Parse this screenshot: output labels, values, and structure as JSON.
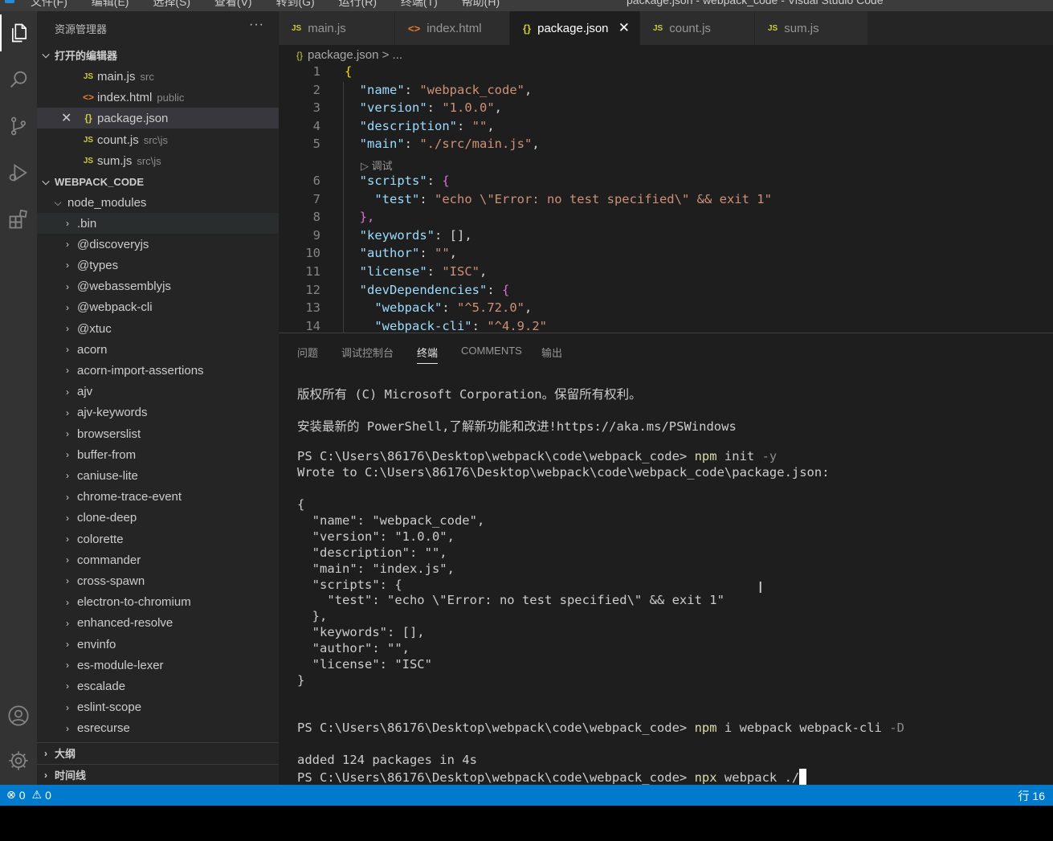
{
  "window": {
    "menus": [
      "文件(F)",
      "编辑(E)",
      "选择(S)",
      "查看(V)",
      "转到(G)",
      "运行(R)",
      "终端(T)",
      "帮助(H)"
    ],
    "title": "package.json - webpack_code - Visual Studio Code"
  },
  "activity_bar": {
    "icons": [
      "files-icon",
      "search-icon",
      "source-control-icon",
      "run-debug-icon",
      "extensions-icon",
      "account-icon",
      "settings-gear-icon"
    ]
  },
  "sidebar": {
    "title": "资源管理器",
    "more": "···",
    "open_editors": {
      "label": "打开的编辑器",
      "items": [
        {
          "icon": "JS",
          "name": "main.js",
          "desc": "src"
        },
        {
          "icon": "<>",
          "name": "index.html",
          "desc": "public"
        },
        {
          "icon": "{}",
          "name": "package.json",
          "desc": ""
        },
        {
          "icon": "JS",
          "name": "count.js",
          "desc": "src\\js"
        },
        {
          "icon": "JS",
          "name": "sum.js",
          "desc": "src\\js"
        }
      ],
      "close_glyph": "✕"
    },
    "project": {
      "label": "WEBPACK_CODE",
      "node_modules": "node_modules",
      "folders": [
        ".bin",
        "@discoveryjs",
        "@types",
        "@webassemblyjs",
        "@webpack-cli",
        "@xtuc",
        "acorn",
        "acorn-import-assertions",
        "ajv",
        "ajv-keywords",
        "browserslist",
        "buffer-from",
        "caniuse-lite",
        "chrome-trace-event",
        "clone-deep",
        "colorette",
        "commander",
        "cross-spawn",
        "electron-to-chromium",
        "enhanced-resolve",
        "envinfo",
        "es-module-lexer",
        "escalade",
        "eslint-scope",
        "esrecurse"
      ]
    },
    "outline": "大纲",
    "timeline": "时间线"
  },
  "tabs": [
    {
      "icon": "JS",
      "label": "main.js",
      "active": false
    },
    {
      "icon": "<>",
      "label": "index.html",
      "active": false
    },
    {
      "icon": "{}",
      "label": "package.json",
      "active": true
    },
    {
      "icon": "JS",
      "label": "count.js",
      "active": false
    },
    {
      "icon": "JS",
      "label": "sum.js",
      "active": false
    }
  ],
  "editor": {
    "breadcrumb": {
      "file": "package.json",
      "rest": " > ..."
    },
    "codelens": "▷ 调试",
    "lines": [
      {
        "n": "1",
        "k": "",
        "v": "",
        "pre": "",
        "open": "{"
      },
      {
        "n": "2",
        "k": "\"name\"",
        "v": "\"webpack_code\""
      },
      {
        "n": "3",
        "k": "\"version\"",
        "v": "\"1.0.0\""
      },
      {
        "n": "4",
        "k": "\"description\"",
        "v": "\"\""
      },
      {
        "n": "5",
        "k": "\"main\"",
        "v": "\"./src/main.js\""
      },
      {
        "n": "6",
        "k": "\"scripts\"",
        "v": "{"
      },
      {
        "n": "7",
        "k": "\"test\"",
        "v": "\"echo \\\"Error: no test specified\\\" && exit 1\""
      },
      {
        "n": "8",
        "k": "",
        "v": "},"
      },
      {
        "n": "9",
        "k": "\"keywords\"",
        "v": "[],"
      },
      {
        "n": "10",
        "k": "\"author\"",
        "v": "\"\""
      },
      {
        "n": "11",
        "k": "\"license\"",
        "v": "\"ISC\""
      },
      {
        "n": "12",
        "k": "\"devDependencies\"",
        "v": "{"
      },
      {
        "n": "13",
        "k": "\"webpack\"",
        "v": "\"^5.72.0\""
      },
      {
        "n": "14",
        "k": "\"webpack-cli\"",
        "v": "\"^4.9.2\""
      }
    ]
  },
  "panel": {
    "tabs": [
      "问题",
      "调试控制台",
      "终端",
      "COMMENTS",
      "输出"
    ],
    "active_tab": "终端",
    "terminal": {
      "copyright": "版权所有 (C) Microsoft Corporation。保留所有权利。",
      "install_hint": "安装最新的 PowerShell,了解新功能和改进!https://aka.ms/PSWindows",
      "prompt": "PS C:\\Users\\86176\\Desktop\\webpack\\code\\webpack_code> ",
      "cmd1": {
        "cmd": "npm",
        "args": " init ",
        "flag": "-y"
      },
      "wrote": "Wrote to C:\\Users\\86176\\Desktop\\webpack\\code\\webpack_code\\package.json:",
      "json": [
        "{",
        "  \"name\": \"webpack_code\",",
        "  \"version\": \"1.0.0\",",
        "  \"description\": \"\",",
        "  \"main\": \"index.js\",",
        "  \"scripts\": {",
        "    \"test\": \"echo \\\"Error: no test specified\\\" && exit 1\"",
        "  },",
        "  \"keywords\": [],",
        "  \"author\": \"\",",
        "  \"license\": \"ISC\"",
        "}"
      ],
      "cmd2": {
        "cmd": "npm",
        "args": " i webpack webpack-cli ",
        "flag": "-D"
      },
      "added": "added 124 packages in 4s",
      "cmd3": {
        "cmd": "npx",
        "args": " webpack ./",
        "flag": ""
      }
    }
  },
  "status_bar": {
    "errors": "0",
    "warnings": "0",
    "position": "行 16"
  },
  "colors": {
    "status": "#007acc",
    "activity": "#333333",
    "sidebar": "#252526",
    "editor": "#1e1e1e"
  }
}
